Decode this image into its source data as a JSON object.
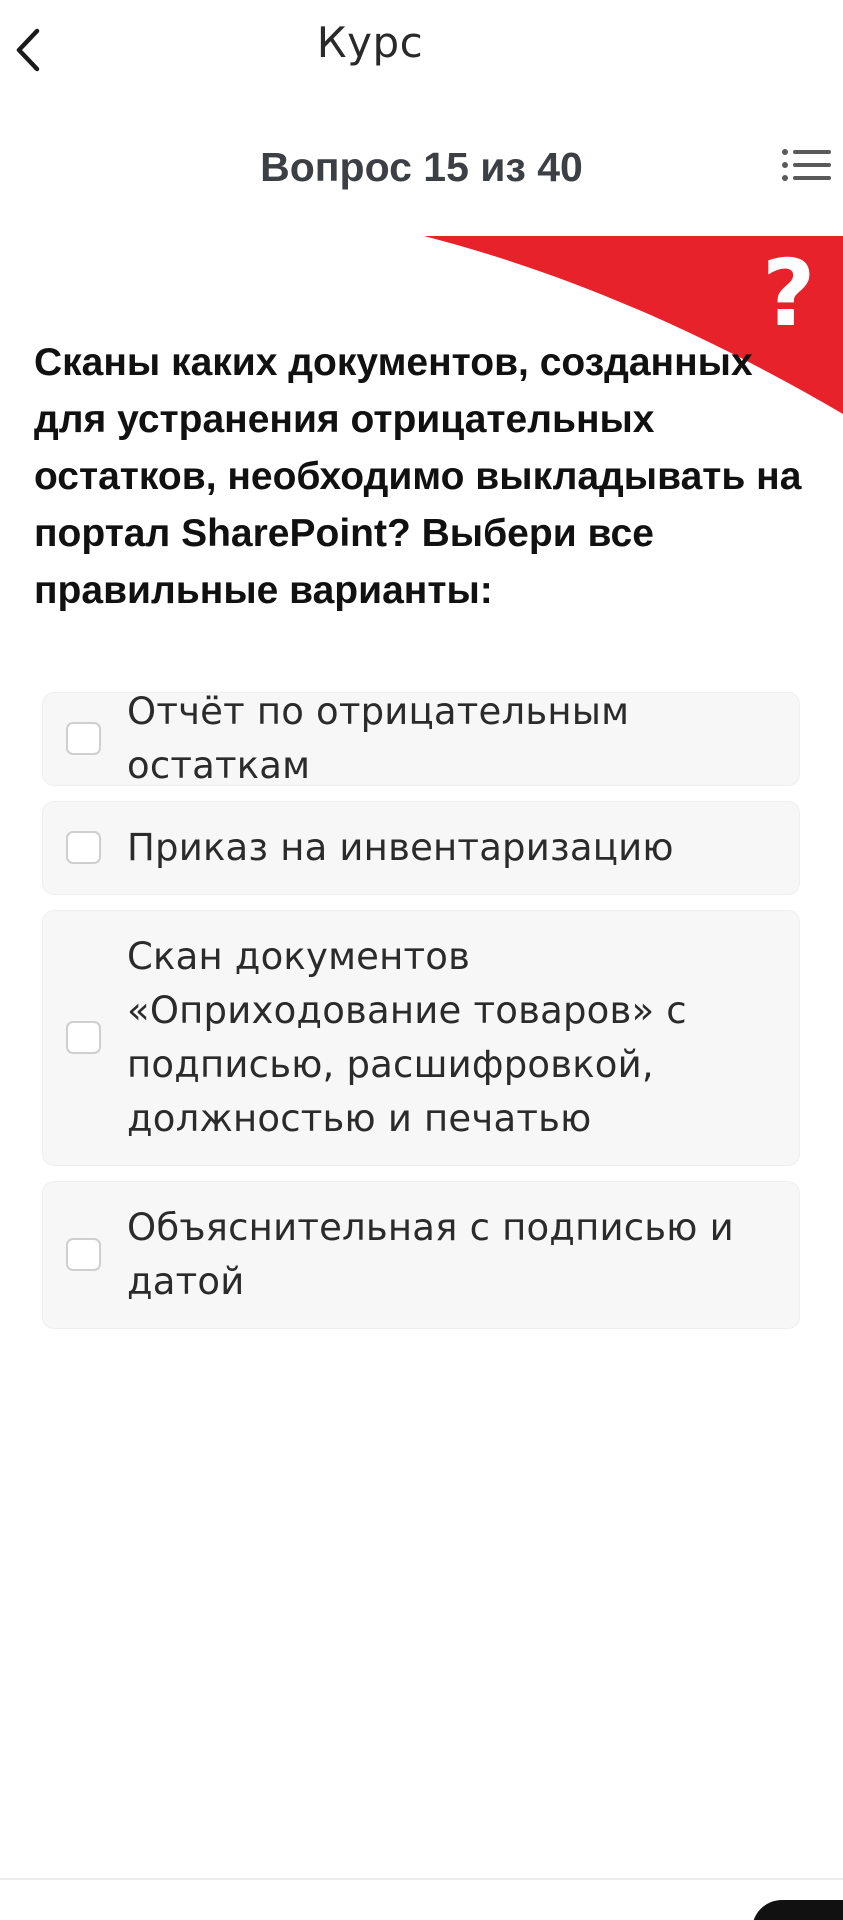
{
  "header": {
    "title": "Курс",
    "back_icon": "chevron-left-icon"
  },
  "quiz": {
    "progress": "Вопрос 15 из 40",
    "menu_icon": "list-menu-icon",
    "banner_color": "#e8222a",
    "banner_mark": "?",
    "question": "Сканы каких документов, созданных для устранения отрицательных остатков, необходимо выкладывать на портал SharePoint? Выбери все правильные варианты:",
    "options": [
      {
        "label": "Отчёт по отрицательным остаткам",
        "checked": false
      },
      {
        "label": "Приказ на инвентаризацию",
        "checked": false
      },
      {
        "label": "Скан документов «Оприходование товаров» с подписью, расшифровкой, должностью и печатью",
        "checked": false
      },
      {
        "label": "Объяснительная с подписью и датой",
        "checked": false
      }
    ]
  }
}
